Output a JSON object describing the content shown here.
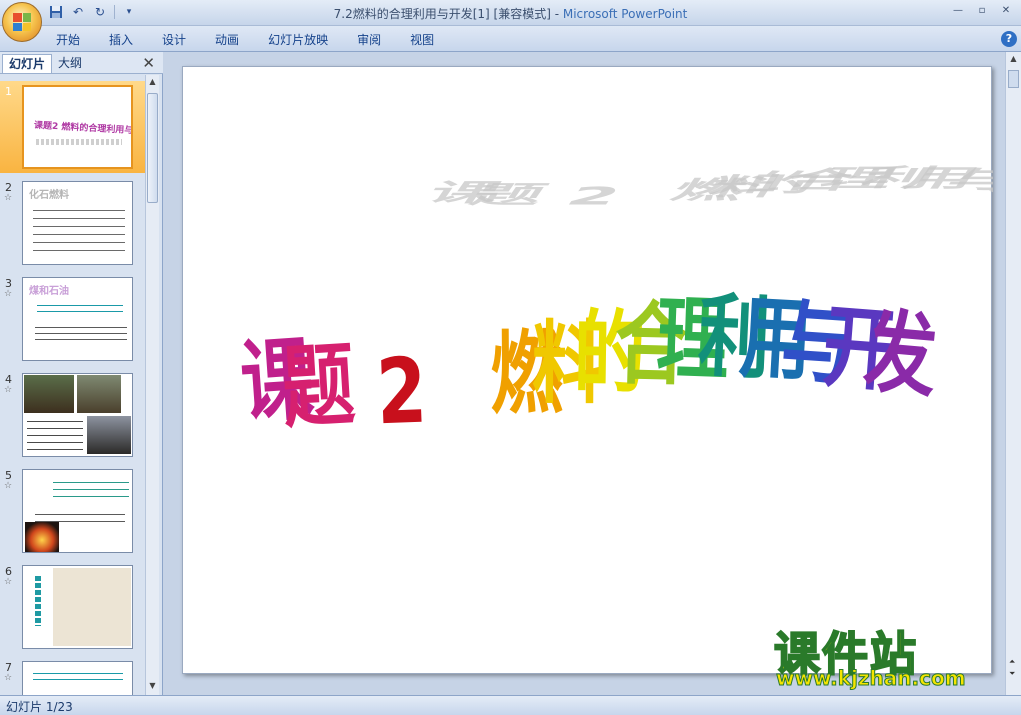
{
  "window": {
    "title": "7.2燃料的合理利用与开发[1] [兼容模式] - ",
    "app_name": "Microsoft PowerPoint",
    "controls": [
      "—",
      "▫",
      "✕"
    ]
  },
  "quick_access": [
    "save-icon",
    "undo-icon",
    "redo-icon"
  ],
  "ribbon": {
    "tabs": [
      "开始",
      "插入",
      "设计",
      "动画",
      "幻灯片放映",
      "审阅",
      "视图"
    ],
    "help": "?"
  },
  "left_pane": {
    "tab_slides": "幻灯片",
    "tab_outline": "大纲",
    "close": "✕",
    "thumbnails": [
      {
        "num": "1",
        "text": "课题2  燃料的合理利用与开发",
        "selected": true
      },
      {
        "num": "2",
        "text": "化石燃料",
        "star": "☆"
      },
      {
        "num": "3",
        "text": "煤和石油",
        "star": "☆"
      },
      {
        "num": "4",
        "text": "",
        "star": "☆"
      },
      {
        "num": "5",
        "text": "",
        "star": "☆"
      },
      {
        "num": "6",
        "text": "",
        "star": "☆"
      },
      {
        "num": "7",
        "text": "",
        "star": "☆"
      }
    ]
  },
  "slide": {
    "title_chars": [
      "课",
      "题",
      " ",
      "2",
      " ",
      " ",
      "燃",
      "料",
      "的",
      "合",
      "理",
      "利",
      "用",
      "与",
      "开",
      "发"
    ]
  },
  "status": {
    "slide_counter": "幻灯片 1/23"
  },
  "watermark": {
    "cn": "课件站",
    "url": "www.kjzhan.com"
  },
  "colors": {
    "accent": "#15428b",
    "selected_thumb": "#f9b441"
  }
}
